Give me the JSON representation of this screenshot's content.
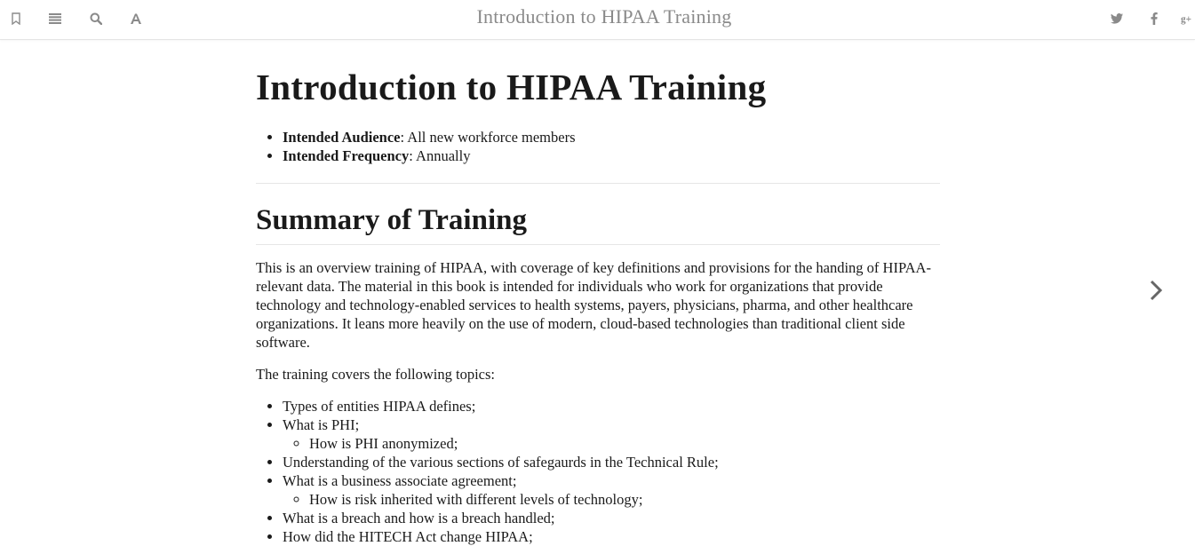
{
  "toolbar": {
    "title": "Introduction to HIPAA Training",
    "left_icons": [
      "bookmark-icon",
      "list-icon",
      "search-icon",
      "font-icon"
    ],
    "right_icons": [
      "twitter-icon",
      "facebook-icon",
      "google-plus-icon"
    ],
    "icon_color": "#8a8a8a"
  },
  "page": {
    "title": "Introduction to HIPAA Training",
    "meta": [
      {
        "label": "Intended Audience",
        "value": ": All new workforce members"
      },
      {
        "label": "Intended Frequency",
        "value": ": Annually"
      }
    ],
    "summary_heading": "Summary of Training",
    "intro_paragraph": "This is an overview training of HIPAA, with coverage of key definitions and provisions for the handing of HIPAA-relevant data. The material in this book is intended for individuals who work for organizations that provide technology and technology-enabled services to health systems, payers, physicians, pharma, and other healthcare organizations. It leans more heavily on the use of modern, cloud-based technologies than traditional client side software.",
    "covers_text": "The training covers the following topics:",
    "topics": [
      "Types of entities HIPAA defines;",
      "What is PHI;",
      "How is PHI anonymized;",
      "Understanding of the various sections of safegaurds in the Technical Rule;",
      "What is a business associate agreement;",
      "How is risk inherited with different levels of technology;",
      "What is a breach and how is a breach handled;",
      "How did the HITECH Act change HIPAA;"
    ]
  },
  "navigation": {
    "next_icon": "chevron-right-icon"
  }
}
